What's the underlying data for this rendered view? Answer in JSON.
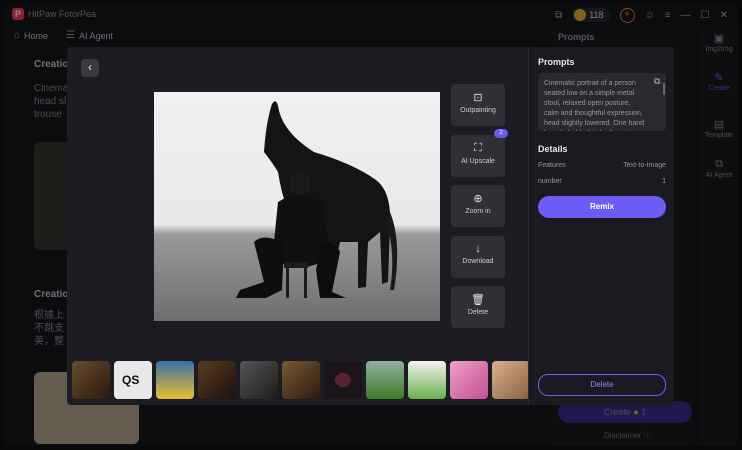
{
  "app": {
    "logo_letter": "P",
    "title": "HitPaw FotorPea"
  },
  "titlebar": {
    "icons": [
      "window-icon",
      "coin-icon",
      "plus-icon",
      "face-icon",
      "menu-icon",
      "minimize-icon",
      "maximize-icon",
      "close-icon"
    ],
    "coins": "118"
  },
  "nav": {
    "home": "Home",
    "ai_agent": "AI Agent"
  },
  "background": {
    "creation1_title": "Creatio",
    "creation1_text": [
      "Cinema",
      "head sl",
      "trouse"
    ],
    "creation2_title": "Creatio",
    "creation2_text": [
      "根據上",
      "不跳支",
      "美，整"
    ],
    "right_title": "Prompts",
    "sidebar": [
      {
        "icon": "image-icon",
        "label": "Img2Img"
      },
      {
        "icon": "create-icon",
        "label": "Create"
      },
      {
        "icon": "template-icon",
        "label": "Template"
      },
      {
        "icon": "agent-icon",
        "label": "AI Agent"
      }
    ],
    "create_button": "Create",
    "create_cost": "1",
    "disclaimer": "Disclaimer"
  },
  "modal": {
    "back_icon": "chevron-left-icon",
    "actions": [
      {
        "icon": "outpainting-icon",
        "label": "Outpainting"
      },
      {
        "icon": "upscale-icon",
        "label": "AI Upscale"
      },
      {
        "icon": "zoom-in-icon",
        "label": "Zoom in"
      },
      {
        "icon": "download-icon",
        "label": "Download"
      },
      {
        "icon": "trash-icon",
        "label": "Delete"
      }
    ],
    "upscale_badge": "2",
    "thumbnail_count": 11
  },
  "side": {
    "prompts_title": "Prompts",
    "prompt_text": "Cinematic portrait of a person seated low on a simple metal stool, relaxed open posture, calm and thoughtful expression, head slightly lowered. One hand loosely holds thin leather reins between",
    "details_title": "Details",
    "details": [
      {
        "key": "Features",
        "value": "Text-to-Image"
      },
      {
        "key": "number",
        "value": "1"
      }
    ],
    "remix": "Remix",
    "delete": "Delete"
  },
  "colors": {
    "accent": "#6b5cf5",
    "brand": "#ff3b58",
    "coin": "#f3b233"
  }
}
